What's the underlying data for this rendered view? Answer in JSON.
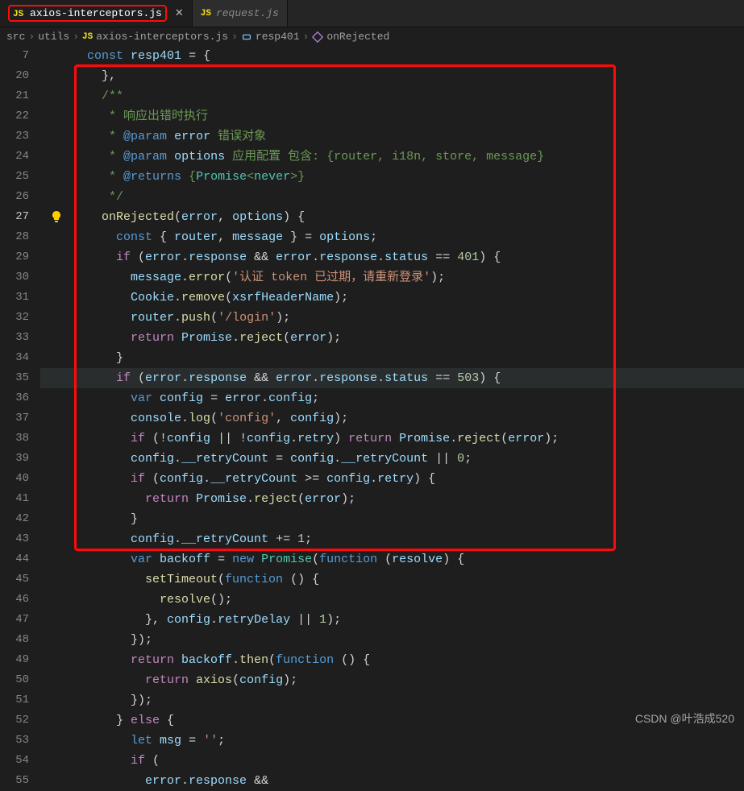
{
  "tabs": [
    {
      "icon": "JS",
      "name": "axios-interceptors.js",
      "active": true,
      "closeable": true,
      "highlighted": true
    },
    {
      "icon": "JS",
      "name": "request.js",
      "active": false,
      "closeable": false
    }
  ],
  "breadcrumb": {
    "parts": [
      "src",
      "utils"
    ],
    "file_icon": "JS",
    "file": "axios-interceptors.js",
    "symbols": [
      {
        "kind": "variable",
        "name": "resp401"
      },
      {
        "kind": "method",
        "name": "onRejected"
      }
    ]
  },
  "watermark": "CSDN @叶浩成520",
  "highlight_box": {
    "top_line_index": 1,
    "bottom_line_index": 24
  },
  "bulb_line_index": 8,
  "current_line_index": 8,
  "lines": [
    {
      "num": "7",
      "indent": 1,
      "tokens": [
        [
          "kw",
          "const"
        ],
        [
          "op",
          " "
        ],
        [
          "var",
          "resp401"
        ],
        [
          "op",
          " = {"
        ]
      ]
    },
    {
      "num": "20",
      "indent": 2,
      "tokens": [
        [
          "op",
          "},"
        ]
      ]
    },
    {
      "num": "21",
      "indent": 2,
      "tokens": [
        [
          "cmt",
          "/**"
        ]
      ]
    },
    {
      "num": "22",
      "indent": 2,
      "tokens": [
        [
          "cmt",
          " * 响应出错时执行"
        ]
      ]
    },
    {
      "num": "23",
      "indent": 2,
      "tokens": [
        [
          "cmt",
          " * "
        ],
        [
          "paramtag",
          "@param"
        ],
        [
          "cmt",
          " "
        ],
        [
          "var",
          "error"
        ],
        [
          "cmt",
          " 错误对象"
        ]
      ]
    },
    {
      "num": "24",
      "indent": 2,
      "tokens": [
        [
          "cmt",
          " * "
        ],
        [
          "paramtag",
          "@param"
        ],
        [
          "cmt",
          " "
        ],
        [
          "var",
          "options"
        ],
        [
          "cmt",
          " 应用配置 包含: {router, i18n, store, message}"
        ]
      ]
    },
    {
      "num": "25",
      "indent": 2,
      "tokens": [
        [
          "cmt",
          " * "
        ],
        [
          "paramtag",
          "@returns"
        ],
        [
          "cmt",
          " {"
        ],
        [
          "type",
          "Promise"
        ],
        [
          "cmt",
          "<"
        ],
        [
          "type",
          "never"
        ],
        [
          "cmt",
          ">}"
        ]
      ]
    },
    {
      "num": "26",
      "indent": 2,
      "tokens": [
        [
          "cmt",
          " */"
        ]
      ]
    },
    {
      "num": "27",
      "indent": 2,
      "tokens": [
        [
          "fn",
          "onRejected"
        ],
        [
          "op",
          "("
        ],
        [
          "var",
          "error"
        ],
        [
          "op",
          ", "
        ],
        [
          "var",
          "options"
        ],
        [
          "op",
          ") {"
        ]
      ]
    },
    {
      "num": "28",
      "indent": 3,
      "tokens": [
        [
          "kw",
          "const"
        ],
        [
          "op",
          " { "
        ],
        [
          "var",
          "router"
        ],
        [
          "op",
          ", "
        ],
        [
          "var",
          "message"
        ],
        [
          "op",
          " } = "
        ],
        [
          "var",
          "options"
        ],
        [
          "op",
          ";"
        ]
      ]
    },
    {
      "num": "29",
      "indent": 3,
      "tokens": [
        [
          "kw2",
          "if"
        ],
        [
          "op",
          " ("
        ],
        [
          "var",
          "error"
        ],
        [
          "op",
          "."
        ],
        [
          "prop",
          "response"
        ],
        [
          "op",
          " && "
        ],
        [
          "var",
          "error"
        ],
        [
          "op",
          "."
        ],
        [
          "prop",
          "response"
        ],
        [
          "op",
          "."
        ],
        [
          "prop",
          "status"
        ],
        [
          "op",
          " == "
        ],
        [
          "num",
          "401"
        ],
        [
          "op",
          ") {"
        ]
      ]
    },
    {
      "num": "30",
      "indent": 4,
      "tokens": [
        [
          "var",
          "message"
        ],
        [
          "op",
          "."
        ],
        [
          "fn",
          "error"
        ],
        [
          "op",
          "("
        ],
        [
          "str",
          "'认证 token 已过期，请重新登录'"
        ],
        [
          "op",
          ");"
        ]
      ]
    },
    {
      "num": "31",
      "indent": 4,
      "tokens": [
        [
          "var",
          "Cookie"
        ],
        [
          "op",
          "."
        ],
        [
          "fn",
          "remove"
        ],
        [
          "op",
          "("
        ],
        [
          "var",
          "xsrfHeaderName"
        ],
        [
          "op",
          ");"
        ]
      ]
    },
    {
      "num": "32",
      "indent": 4,
      "tokens": [
        [
          "var",
          "router"
        ],
        [
          "op",
          "."
        ],
        [
          "fn",
          "push"
        ],
        [
          "op",
          "("
        ],
        [
          "str",
          "'/login'"
        ],
        [
          "op",
          ");"
        ]
      ]
    },
    {
      "num": "33",
      "indent": 4,
      "tokens": [
        [
          "kw2",
          "return"
        ],
        [
          "op",
          " "
        ],
        [
          "var",
          "Promise"
        ],
        [
          "op",
          "."
        ],
        [
          "fn",
          "reject"
        ],
        [
          "op",
          "("
        ],
        [
          "var",
          "error"
        ],
        [
          "op",
          ");"
        ]
      ]
    },
    {
      "num": "34",
      "indent": 3,
      "tokens": [
        [
          "op",
          "}"
        ]
      ]
    },
    {
      "num": "35",
      "indent": 3,
      "hl": true,
      "tokens": [
        [
          "kw2",
          "if"
        ],
        [
          "op",
          " ("
        ],
        [
          "var",
          "error"
        ],
        [
          "op",
          "."
        ],
        [
          "prop",
          "response"
        ],
        [
          "op",
          " && "
        ],
        [
          "var",
          "error"
        ],
        [
          "op",
          "."
        ],
        [
          "prop",
          "response"
        ],
        [
          "op",
          "."
        ],
        [
          "prop",
          "status"
        ],
        [
          "op",
          " == "
        ],
        [
          "num",
          "503"
        ],
        [
          "op",
          ") {"
        ]
      ]
    },
    {
      "num": "36",
      "indent": 4,
      "tokens": [
        [
          "kw",
          "var"
        ],
        [
          "op",
          " "
        ],
        [
          "var",
          "config"
        ],
        [
          "op",
          " = "
        ],
        [
          "var",
          "error"
        ],
        [
          "op",
          "."
        ],
        [
          "prop",
          "config"
        ],
        [
          "op",
          ";"
        ]
      ]
    },
    {
      "num": "37",
      "indent": 4,
      "tokens": [
        [
          "var",
          "console"
        ],
        [
          "op",
          "."
        ],
        [
          "fn",
          "log"
        ],
        [
          "op",
          "("
        ],
        [
          "str",
          "'config'"
        ],
        [
          "op",
          ", "
        ],
        [
          "var",
          "config"
        ],
        [
          "op",
          ");"
        ]
      ]
    },
    {
      "num": "38",
      "indent": 4,
      "tokens": [
        [
          "kw2",
          "if"
        ],
        [
          "op",
          " (!"
        ],
        [
          "var",
          "config"
        ],
        [
          "op",
          " || !"
        ],
        [
          "var",
          "config"
        ],
        [
          "op",
          "."
        ],
        [
          "prop",
          "retry"
        ],
        [
          "op",
          ") "
        ],
        [
          "kw2",
          "return"
        ],
        [
          "op",
          " "
        ],
        [
          "var",
          "Promise"
        ],
        [
          "op",
          "."
        ],
        [
          "fn",
          "reject"
        ],
        [
          "op",
          "("
        ],
        [
          "var",
          "error"
        ],
        [
          "op",
          ");"
        ]
      ]
    },
    {
      "num": "39",
      "indent": 4,
      "tokens": [
        [
          "var",
          "config"
        ],
        [
          "op",
          "."
        ],
        [
          "prop",
          "__retryCount"
        ],
        [
          "op",
          " = "
        ],
        [
          "var",
          "config"
        ],
        [
          "op",
          "."
        ],
        [
          "prop",
          "__retryCount"
        ],
        [
          "op",
          " || "
        ],
        [
          "num",
          "0"
        ],
        [
          "op",
          ";"
        ]
      ]
    },
    {
      "num": "40",
      "indent": 4,
      "tokens": [
        [
          "kw2",
          "if"
        ],
        [
          "op",
          " ("
        ],
        [
          "var",
          "config"
        ],
        [
          "op",
          "."
        ],
        [
          "prop",
          "__retryCount"
        ],
        [
          "op",
          " >= "
        ],
        [
          "var",
          "config"
        ],
        [
          "op",
          "."
        ],
        [
          "prop",
          "retry"
        ],
        [
          "op",
          ") {"
        ]
      ]
    },
    {
      "num": "41",
      "indent": 5,
      "tokens": [
        [
          "kw2",
          "return"
        ],
        [
          "op",
          " "
        ],
        [
          "var",
          "Promise"
        ],
        [
          "op",
          "."
        ],
        [
          "fn",
          "reject"
        ],
        [
          "op",
          "("
        ],
        [
          "var",
          "error"
        ],
        [
          "op",
          ");"
        ]
      ]
    },
    {
      "num": "42",
      "indent": 4,
      "tokens": [
        [
          "op",
          "}"
        ]
      ]
    },
    {
      "num": "43",
      "indent": 4,
      "tokens": [
        [
          "var",
          "config"
        ],
        [
          "op",
          "."
        ],
        [
          "prop",
          "__retryCount"
        ],
        [
          "op",
          " += "
        ],
        [
          "num",
          "1"
        ],
        [
          "op",
          ";"
        ]
      ]
    },
    {
      "num": "44",
      "indent": 4,
      "tokens": [
        [
          "kw",
          "var"
        ],
        [
          "op",
          " "
        ],
        [
          "var",
          "backoff"
        ],
        [
          "op",
          " = "
        ],
        [
          "kw",
          "new"
        ],
        [
          "op",
          " "
        ],
        [
          "type",
          "Promise"
        ],
        [
          "op",
          "("
        ],
        [
          "kw",
          "function"
        ],
        [
          "op",
          " ("
        ],
        [
          "var",
          "resolve"
        ],
        [
          "op",
          ") {"
        ]
      ]
    },
    {
      "num": "45",
      "indent": 5,
      "tokens": [
        [
          "fn",
          "setTimeout"
        ],
        [
          "op",
          "("
        ],
        [
          "kw",
          "function"
        ],
        [
          "op",
          " () {"
        ]
      ]
    },
    {
      "num": "46",
      "indent": 6,
      "tokens": [
        [
          "fn",
          "resolve"
        ],
        [
          "op",
          "();"
        ]
      ]
    },
    {
      "num": "47",
      "indent": 5,
      "tokens": [
        [
          "op",
          "}, "
        ],
        [
          "var",
          "config"
        ],
        [
          "op",
          "."
        ],
        [
          "prop",
          "retryDelay"
        ],
        [
          "op",
          " || "
        ],
        [
          "num",
          "1"
        ],
        [
          "op",
          ");"
        ]
      ]
    },
    {
      "num": "48",
      "indent": 4,
      "tokens": [
        [
          "op",
          "});"
        ]
      ]
    },
    {
      "num": "49",
      "indent": 4,
      "tokens": [
        [
          "kw2",
          "return"
        ],
        [
          "op",
          " "
        ],
        [
          "var",
          "backoff"
        ],
        [
          "op",
          "."
        ],
        [
          "fn",
          "then"
        ],
        [
          "op",
          "("
        ],
        [
          "kw",
          "function"
        ],
        [
          "op",
          " () {"
        ]
      ]
    },
    {
      "num": "50",
      "indent": 5,
      "tokens": [
        [
          "kw2",
          "return"
        ],
        [
          "op",
          " "
        ],
        [
          "fn",
          "axios"
        ],
        [
          "op",
          "("
        ],
        [
          "var",
          "config"
        ],
        [
          "op",
          ");"
        ]
      ]
    },
    {
      "num": "51",
      "indent": 4,
      "tokens": [
        [
          "op",
          "});"
        ]
      ]
    },
    {
      "num": "52",
      "indent": 3,
      "tokens": [
        [
          "op",
          "} "
        ],
        [
          "kw2",
          "else"
        ],
        [
          "op",
          " {"
        ]
      ]
    },
    {
      "num": "53",
      "indent": 4,
      "tokens": [
        [
          "kw",
          "let"
        ],
        [
          "op",
          " "
        ],
        [
          "var",
          "msg"
        ],
        [
          "op",
          " = "
        ],
        [
          "str",
          "''"
        ],
        [
          "op",
          ";"
        ]
      ]
    },
    {
      "num": "54",
      "indent": 4,
      "tokens": [
        [
          "kw2",
          "if"
        ],
        [
          "op",
          " ("
        ]
      ]
    },
    {
      "num": "55",
      "indent": 5,
      "tokens": [
        [
          "var",
          "error"
        ],
        [
          "op",
          "."
        ],
        [
          "prop",
          "response"
        ],
        [
          "op",
          " &&"
        ]
      ]
    }
  ]
}
